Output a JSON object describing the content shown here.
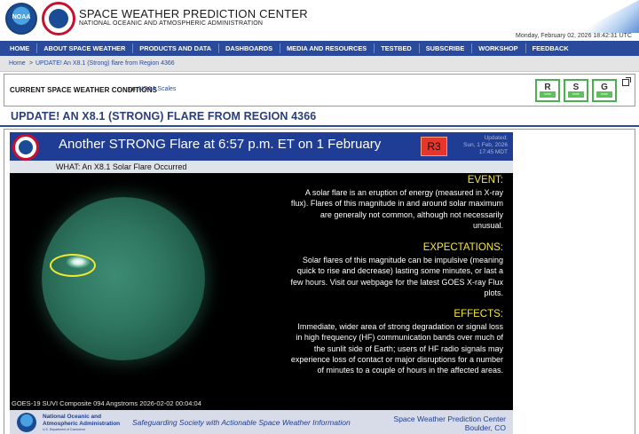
{
  "header": {
    "logo_text": "NOAA",
    "title": "SPACE WEATHER PREDICTION CENTER",
    "subtitle": "NATIONAL OCEANIC AND ATMOSPHERIC ADMINISTRATION",
    "datetime": "Monday, February 02, 2026 18:42:31 UTC"
  },
  "nav": {
    "items": [
      "HOME",
      "ABOUT SPACE WEATHER",
      "PRODUCTS AND DATA",
      "DASHBOARDS",
      "MEDIA AND RESOURCES",
      "TESTBED",
      "SUBSCRIBE",
      "WORKSHOP",
      "FEEDBACK"
    ]
  },
  "breadcrumb": {
    "home": "Home",
    "sep": ">",
    "current": "UPDATE! An X8.1 (Strong) flare from Region 4366"
  },
  "conditions": {
    "title": "CURRENT SPACE WEATHER CONDITIONS",
    "on": "on",
    "link": "NOAA Scales",
    "scales": [
      {
        "letter": "R",
        "status": "none",
        "color": "#5bc25b"
      },
      {
        "letter": "S",
        "status": "none",
        "color": "#5bc25b"
      },
      {
        "letter": "G",
        "status": "none",
        "color": "#5bc25b"
      }
    ]
  },
  "page": {
    "title": "UPDATE! AN X8.1 (STRONG) FLARE FROM REGION 4366"
  },
  "infographic": {
    "headline": "Another STRONG Flare at 6:57 p.m. ET on 1 February",
    "scale_badge": "R3",
    "updated_label": "Updated:",
    "updated_date": "Sun, 1 Feb, 2026",
    "updated_time": "17:45 MDT",
    "what": "WHAT: An X8.1 Solar Flare Occurred",
    "event_title": "EVENT:",
    "event_text": "A solar flare is an eruption of energy (measured in X-ray flux). Flares of this magnitude in and around solar maximum are generally not common, although not necessarily unusual.",
    "expectations_title": "EXPECTATIONS:",
    "expectations_text": "Solar flares of this magnitude can be impulsive (meaning quick to rise and decrease) lasting some minutes, or last a few hours. Visit our webpage for the latest GOES X-ray Flux plots.",
    "effects_title": "EFFECTS:",
    "effects_text": "Immediate, wider area of strong degradation or signal loss in high frequency (HF) communication bands over much of the sunlit side of Earth; users of HF radio signals may experience loss of contact or major disruptions for a number of minutes to a couple of hours in the affected areas.",
    "caption": "GOES-19 SUVI Composite 094 Angstroms 2026-02-02 00:04:04",
    "footer_org_line1": "National Oceanic and",
    "footer_org_line2": "Atmospheric Administration",
    "footer_dept": "U.S. Department of Commerce",
    "footer_tagline": "Safeguarding Society with Actionable Space Weather Information",
    "footer_center": "Space Weather Prediction Center",
    "footer_location": "Boulder, CO"
  },
  "colors": {
    "nav_bg": "#2a4b9b",
    "title_color": "#2a3e78",
    "badge_r3": "#e8352b",
    "section_heading": "#f7e73a",
    "scale_ok": "#5bc25b"
  }
}
